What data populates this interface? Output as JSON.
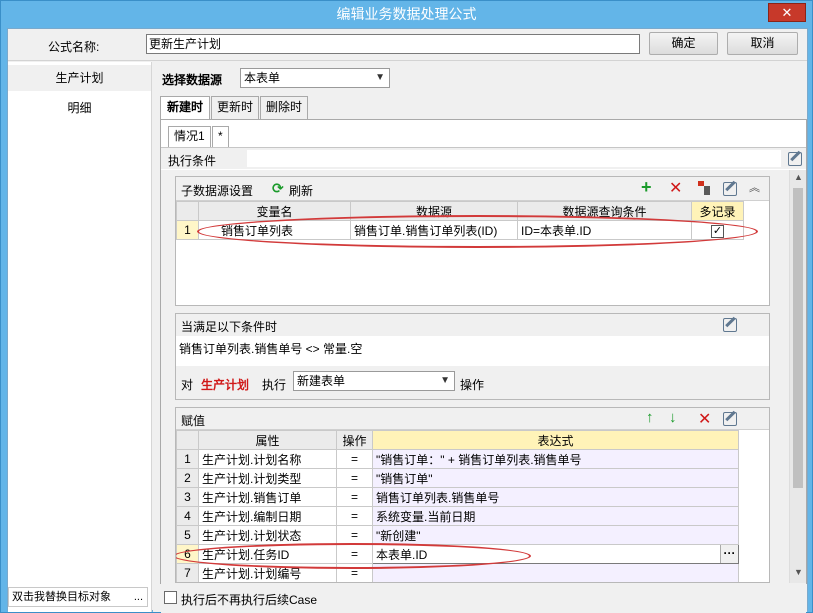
{
  "window": {
    "title": "编辑业务数据处理公式",
    "close_icon": "close-icon"
  },
  "form": {
    "name_label": "公式名称:",
    "name_value": "更新生产计划",
    "ok_label": "确定",
    "cancel_label": "取消"
  },
  "sidebar": {
    "items": [
      {
        "label": "生产计划"
      },
      {
        "label": "明细"
      }
    ],
    "bottom_text": "双击我替换目标对象",
    "bottom_dots": "..."
  },
  "source": {
    "label": "选择数据源",
    "value": "本表单"
  },
  "tabs": [
    {
      "label": "新建时"
    },
    {
      "label": "更新时"
    },
    {
      "label": "删除时"
    }
  ],
  "case_tabs": [
    {
      "label": "情况1"
    },
    {
      "label": "*"
    }
  ],
  "exec_condition_label": "执行条件",
  "subsource": {
    "title": "子数据源设置",
    "refresh_label": "刷新",
    "columns": [
      "变量名",
      "数据源",
      "数据源查询条件",
      "多记录"
    ],
    "rows": [
      {
        "num": "1",
        "var": "销售订单列表",
        "source": "销售订单.销售订单列表(ID)",
        "query": "ID=本表单.ID",
        "multi": true
      }
    ]
  },
  "condition": {
    "title": "当满足以下条件时",
    "expr": "销售订单列表.销售单号 <> 常量.空",
    "target_prefix": "对",
    "target_name": "生产计划",
    "exec_label": "执行",
    "action_value": "新建表单",
    "op_label": "操作"
  },
  "assign": {
    "title": "赋值",
    "columns": [
      "属性",
      "操作",
      "表达式"
    ],
    "rows": [
      {
        "num": "1",
        "prop": "生产计划.计划名称",
        "op": "=",
        "expr": "\"销售订单：\" + 销售订单列表.销售单号"
      },
      {
        "num": "2",
        "prop": "生产计划.计划类型",
        "op": "=",
        "expr": "\"销售订单\""
      },
      {
        "num": "3",
        "prop": "生产计划.销售订单",
        "op": "=",
        "expr": "销售订单列表.销售单号"
      },
      {
        "num": "4",
        "prop": "生产计划.编制日期",
        "op": "=",
        "expr": "系统变量.当前日期"
      },
      {
        "num": "5",
        "prop": "生产计划.计划状态",
        "op": "=",
        "expr": "\"新创建\""
      },
      {
        "num": "6",
        "prop": "生产计划.任务ID",
        "op": "=",
        "expr": "本表单.ID"
      },
      {
        "num": "7",
        "prop": "生产计划.计划编号",
        "op": "=",
        "expr": ""
      }
    ],
    "row6_dots": "···"
  },
  "footer": {
    "checkbox_label": "执行后不再执行后续Case"
  },
  "colors": {
    "title_bg": "#63b5e8",
    "close_bg": "#c7392a",
    "highlight": "#d23a3a",
    "green": "#1a9a2a",
    "red": "#d01818"
  }
}
